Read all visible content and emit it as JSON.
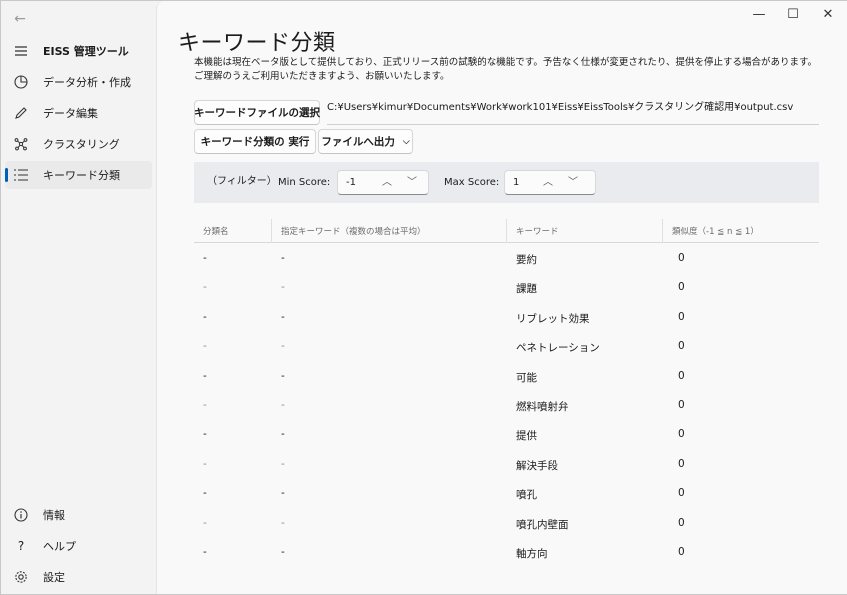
{
  "sidebar": {
    "app_title": "EISS 管理ツール",
    "items": [
      {
        "label": "データ分析・作成"
      },
      {
        "label": "データ編集"
      },
      {
        "label": "クラスタリング"
      },
      {
        "label": "キーワード分類"
      }
    ],
    "footer_items": [
      {
        "label": "情報"
      },
      {
        "label": "ヘルプ"
      },
      {
        "label": "設定"
      }
    ]
  },
  "window": {
    "minimize": "—",
    "maximize": "☐",
    "close": "✕"
  },
  "page": {
    "title": "キーワード分類",
    "description_line1": "本機能は現在ベータ版として提供しており、正式リリース前の試験的な機能です。予告なく仕様が変更されたり、提供を停止する場合があります。",
    "description_line2": "ご理解のうえご利用いただきますよう、お願いいたします。"
  },
  "toolbar": {
    "select_file_label": "キーワードファイルの選択",
    "file_path": "C:¥Users¥kimur¥Documents¥Work¥work101¥Eiss¥EissTools¥クラスタリング確認用¥output.csv",
    "run_label": "キーワード分類の 実行",
    "export_label": "ファイルへ出力"
  },
  "filter": {
    "label": "（フィルター）",
    "min_label": "Min Score:",
    "min_value": "-1",
    "max_label": "Max Score:",
    "max_value": "1"
  },
  "table": {
    "headers": [
      "分類名",
      "指定キーワード（複数の場合は平均）",
      "キーワード",
      "類似度（-1 ≦ n ≦ 1）"
    ],
    "rows": [
      [
        "-",
        "-",
        "要約",
        "0"
      ],
      [
        "-",
        "-",
        "課題",
        "0"
      ],
      [
        "-",
        "-",
        "リブレット効果",
        "0"
      ],
      [
        "-",
        "-",
        "ペネトレーション",
        "0"
      ],
      [
        "-",
        "-",
        "可能",
        "0"
      ],
      [
        "-",
        "-",
        "燃料噴射弁",
        "0"
      ],
      [
        "-",
        "-",
        "提供",
        "0"
      ],
      [
        "-",
        "-",
        "解決手段",
        "0"
      ],
      [
        "-",
        "-",
        "噴孔",
        "0"
      ],
      [
        "-",
        "-",
        "噴孔内壁面",
        "0"
      ],
      [
        "-",
        "-",
        "軸方向",
        "0"
      ]
    ]
  },
  "colors": {
    "accent": "#005fb8",
    "sidebar_bg": "#f3f3f3",
    "content_bg": "#f9f9f9",
    "filter_bg": "#e9ebee"
  }
}
